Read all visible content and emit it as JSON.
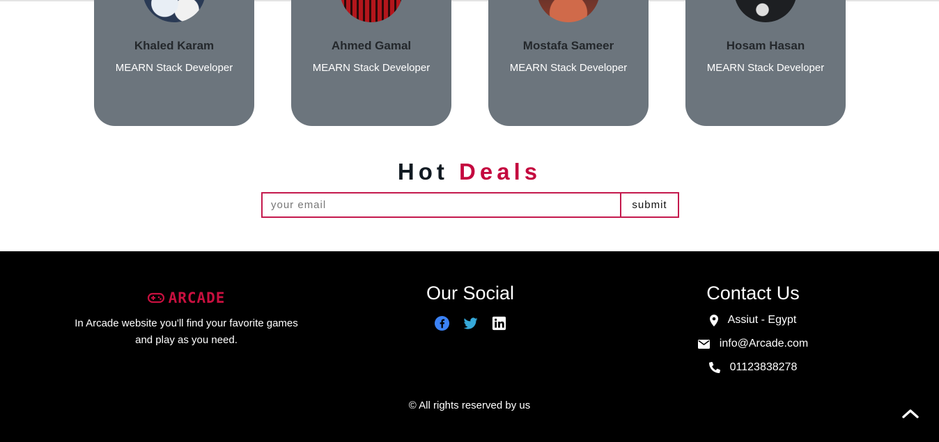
{
  "team": [
    {
      "name": "Khaled Karam",
      "role": "MEARN Stack Developer"
    },
    {
      "name": "Ahmed Gamal",
      "role": "MEARN Stack Developer"
    },
    {
      "name": "Mostafa Sameer",
      "role": "MEARN Stack Developer"
    },
    {
      "name": "Hosam Hasan",
      "role": "MEARN Stack Developer"
    }
  ],
  "deals": {
    "title_plain": "Hot",
    "title_accent": "Deals",
    "placeholder": "your email",
    "submit_label": "submit"
  },
  "footer": {
    "brand_name": "ARCADE",
    "about": "In Arcade website you'll find your favorite games and play as you need.",
    "social_title": "Our Social",
    "social_icons": [
      "facebook-icon",
      "twitter-icon",
      "linkedin-icon"
    ],
    "contact_title": "Contact Us",
    "location": "Assiut - Egypt",
    "email": "info@Arcade.com",
    "phone": "01123838278",
    "copyright": "© All rights reserved by us"
  },
  "colors": {
    "accent": "#c4093f",
    "card_bg": "#6c757d",
    "footer_bg": "#000000",
    "facebook": "#3b82f6",
    "twitter": "#1da1f2"
  }
}
